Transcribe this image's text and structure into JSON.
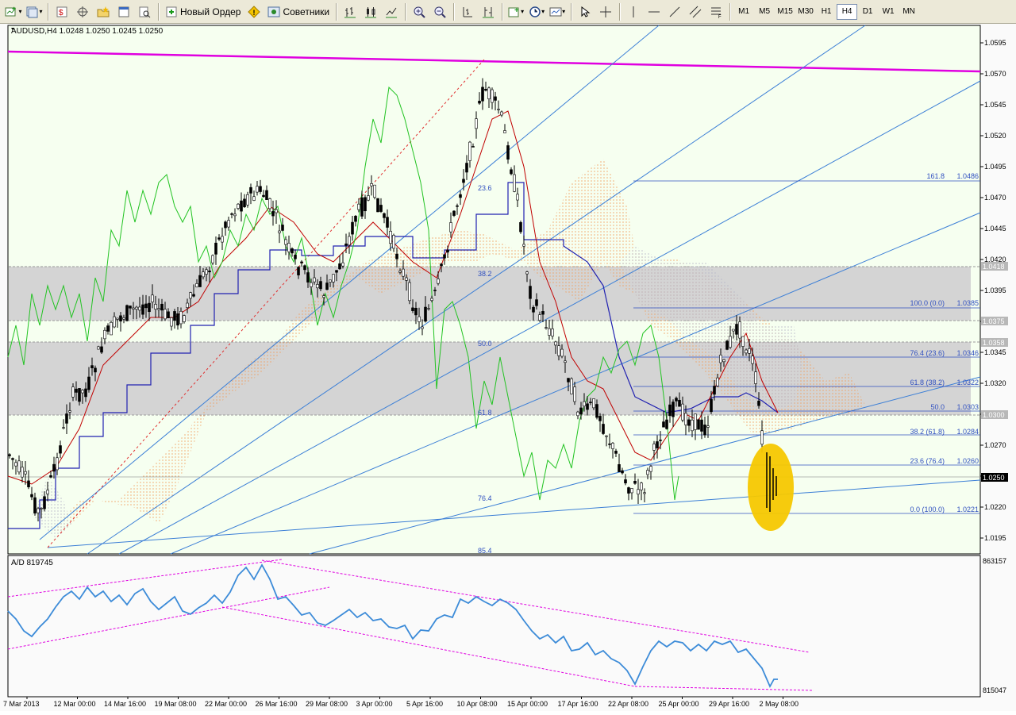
{
  "toolbar": {
    "new_order_label": "Новый Ордер",
    "experts_label": "Советники",
    "timeframes": [
      "M1",
      "M5",
      "M15",
      "M30",
      "H1",
      "H4",
      "D1",
      "W1",
      "MN"
    ],
    "active_timeframe": "H4"
  },
  "chart": {
    "header": "AUDUSD,H4  1.0248 1.0250 1.0245 1.0250",
    "price_ticks": [
      "1.0595",
      "1.0570",
      "1.0545",
      "1.0520",
      "1.0495",
      "1.0470",
      "1.0445",
      "1.0420",
      "1.0395",
      "1.0370",
      "1.0345",
      "1.0320",
      "1.0295",
      "1.0270",
      "1.0245",
      "1.0220",
      "1.0195"
    ],
    "price_tags": [
      "1.0418",
      "1.0375",
      "1.0358",
      "1.0300",
      "1.0250"
    ],
    "current_price": "1.0250",
    "time_labels": [
      "7 Mar 2013",
      "12 Mar 00:00",
      "14 Mar 16:00",
      "19 Mar 08:00",
      "22 Mar 00:00",
      "26 Mar 16:00",
      "29 Mar 08:00",
      "3 Apr 00:00",
      "5 Apr 16:00",
      "10 Apr 08:00",
      "15 Apr 00:00",
      "17 Apr 16:00",
      "22 Apr 08:00",
      "25 Apr 00:00",
      "29 Apr 16:00",
      "2 May 08:00"
    ],
    "fib_left": [
      "23.6",
      "38.2",
      "50.0",
      "61.8",
      "76.4",
      "85.4"
    ],
    "fib_right": [
      {
        "label": "161.8",
        "value": "1.0486"
      },
      {
        "label": "100.0 (0.0)",
        "value": "1.0385"
      },
      {
        "label": "76.4 (23.6)",
        "value": "1.0346"
      },
      {
        "label": "61.8 (38.2)",
        "value": "1.0322"
      },
      {
        "label": "50.0",
        "value": "1.0303"
      },
      {
        "label": "38.2 (61.8)",
        "value": "1.0284"
      },
      {
        "label": "23.6 (76.4)",
        "value": "1.0260"
      },
      {
        "label": "0.0 (100.0)",
        "value": "1.0221"
      }
    ]
  },
  "indicator": {
    "header": "A/D 819745",
    "scale_top": "863157",
    "scale_bottom": "815047"
  },
  "colors": {
    "magenta_line": "#e000e0",
    "blue_line": "#3c7fd6",
    "zone_grey": "#d4d4d4",
    "highlight": "#f5c800",
    "lime": "#22c322"
  }
}
